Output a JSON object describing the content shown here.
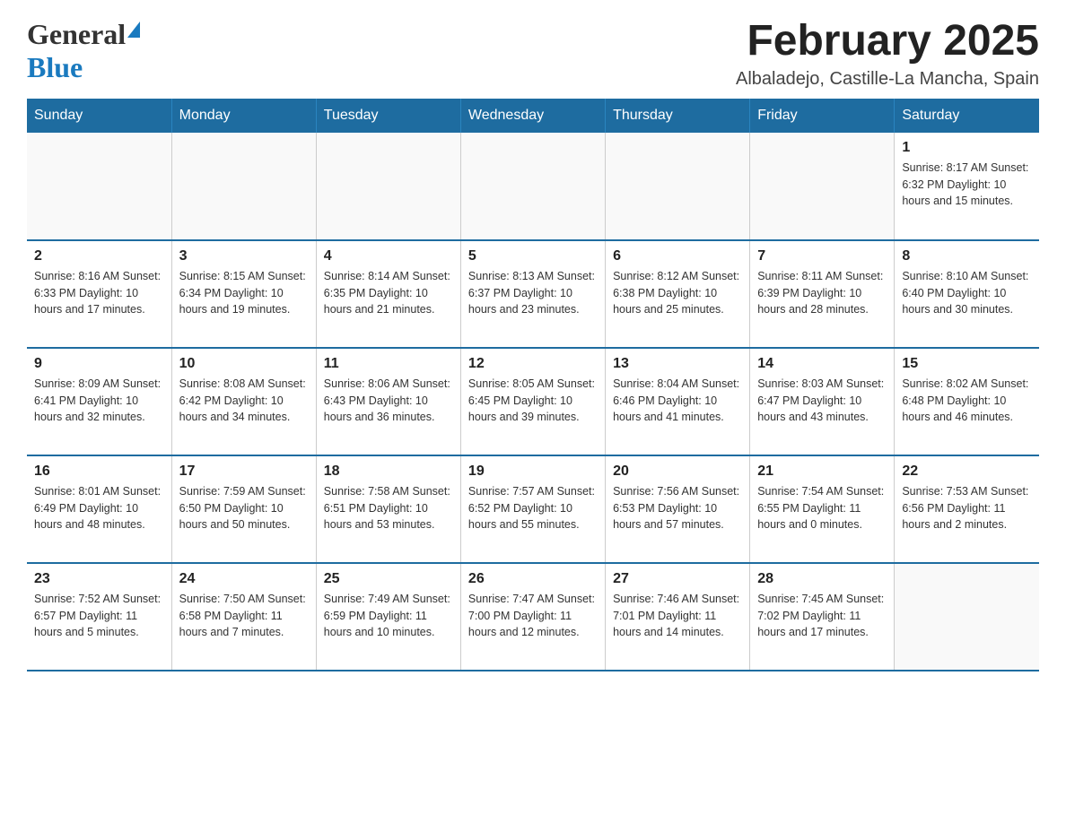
{
  "header": {
    "logo_general": "General",
    "logo_arrow": "▶",
    "logo_blue": "Blue",
    "title": "February 2025",
    "subtitle": "Albaladejo, Castille-La Mancha, Spain"
  },
  "calendar": {
    "days_of_week": [
      "Sunday",
      "Monday",
      "Tuesday",
      "Wednesday",
      "Thursday",
      "Friday",
      "Saturday"
    ],
    "weeks": [
      [
        {
          "day": "",
          "info": ""
        },
        {
          "day": "",
          "info": ""
        },
        {
          "day": "",
          "info": ""
        },
        {
          "day": "",
          "info": ""
        },
        {
          "day": "",
          "info": ""
        },
        {
          "day": "",
          "info": ""
        },
        {
          "day": "1",
          "info": "Sunrise: 8:17 AM\nSunset: 6:32 PM\nDaylight: 10 hours and 15 minutes."
        }
      ],
      [
        {
          "day": "2",
          "info": "Sunrise: 8:16 AM\nSunset: 6:33 PM\nDaylight: 10 hours and 17 minutes."
        },
        {
          "day": "3",
          "info": "Sunrise: 8:15 AM\nSunset: 6:34 PM\nDaylight: 10 hours and 19 minutes."
        },
        {
          "day": "4",
          "info": "Sunrise: 8:14 AM\nSunset: 6:35 PM\nDaylight: 10 hours and 21 minutes."
        },
        {
          "day": "5",
          "info": "Sunrise: 8:13 AM\nSunset: 6:37 PM\nDaylight: 10 hours and 23 minutes."
        },
        {
          "day": "6",
          "info": "Sunrise: 8:12 AM\nSunset: 6:38 PM\nDaylight: 10 hours and 25 minutes."
        },
        {
          "day": "7",
          "info": "Sunrise: 8:11 AM\nSunset: 6:39 PM\nDaylight: 10 hours and 28 minutes."
        },
        {
          "day": "8",
          "info": "Sunrise: 8:10 AM\nSunset: 6:40 PM\nDaylight: 10 hours and 30 minutes."
        }
      ],
      [
        {
          "day": "9",
          "info": "Sunrise: 8:09 AM\nSunset: 6:41 PM\nDaylight: 10 hours and 32 minutes."
        },
        {
          "day": "10",
          "info": "Sunrise: 8:08 AM\nSunset: 6:42 PM\nDaylight: 10 hours and 34 minutes."
        },
        {
          "day": "11",
          "info": "Sunrise: 8:06 AM\nSunset: 6:43 PM\nDaylight: 10 hours and 36 minutes."
        },
        {
          "day": "12",
          "info": "Sunrise: 8:05 AM\nSunset: 6:45 PM\nDaylight: 10 hours and 39 minutes."
        },
        {
          "day": "13",
          "info": "Sunrise: 8:04 AM\nSunset: 6:46 PM\nDaylight: 10 hours and 41 minutes."
        },
        {
          "day": "14",
          "info": "Sunrise: 8:03 AM\nSunset: 6:47 PM\nDaylight: 10 hours and 43 minutes."
        },
        {
          "day": "15",
          "info": "Sunrise: 8:02 AM\nSunset: 6:48 PM\nDaylight: 10 hours and 46 minutes."
        }
      ],
      [
        {
          "day": "16",
          "info": "Sunrise: 8:01 AM\nSunset: 6:49 PM\nDaylight: 10 hours and 48 minutes."
        },
        {
          "day": "17",
          "info": "Sunrise: 7:59 AM\nSunset: 6:50 PM\nDaylight: 10 hours and 50 minutes."
        },
        {
          "day": "18",
          "info": "Sunrise: 7:58 AM\nSunset: 6:51 PM\nDaylight: 10 hours and 53 minutes."
        },
        {
          "day": "19",
          "info": "Sunrise: 7:57 AM\nSunset: 6:52 PM\nDaylight: 10 hours and 55 minutes."
        },
        {
          "day": "20",
          "info": "Sunrise: 7:56 AM\nSunset: 6:53 PM\nDaylight: 10 hours and 57 minutes."
        },
        {
          "day": "21",
          "info": "Sunrise: 7:54 AM\nSunset: 6:55 PM\nDaylight: 11 hours and 0 minutes."
        },
        {
          "day": "22",
          "info": "Sunrise: 7:53 AM\nSunset: 6:56 PM\nDaylight: 11 hours and 2 minutes."
        }
      ],
      [
        {
          "day": "23",
          "info": "Sunrise: 7:52 AM\nSunset: 6:57 PM\nDaylight: 11 hours and 5 minutes."
        },
        {
          "day": "24",
          "info": "Sunrise: 7:50 AM\nSunset: 6:58 PM\nDaylight: 11 hours and 7 minutes."
        },
        {
          "day": "25",
          "info": "Sunrise: 7:49 AM\nSunset: 6:59 PM\nDaylight: 11 hours and 10 minutes."
        },
        {
          "day": "26",
          "info": "Sunrise: 7:47 AM\nSunset: 7:00 PM\nDaylight: 11 hours and 12 minutes."
        },
        {
          "day": "27",
          "info": "Sunrise: 7:46 AM\nSunset: 7:01 PM\nDaylight: 11 hours and 14 minutes."
        },
        {
          "day": "28",
          "info": "Sunrise: 7:45 AM\nSunset: 7:02 PM\nDaylight: 11 hours and 17 minutes."
        },
        {
          "day": "",
          "info": ""
        }
      ]
    ]
  }
}
